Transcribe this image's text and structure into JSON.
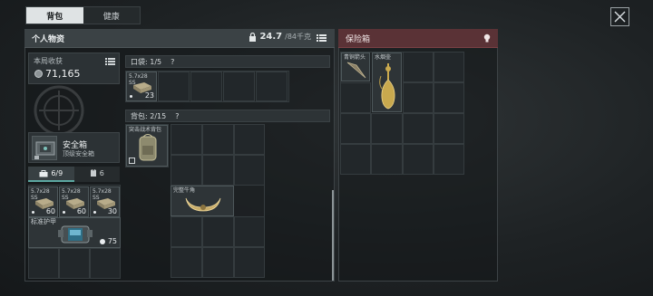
{
  "tabs": [
    {
      "label": "背包"
    },
    {
      "label": "健康"
    }
  ],
  "panel": {
    "title": "个人物资",
    "weight": "24.7",
    "weight_max": "/84千克"
  },
  "loot": {
    "label": "本局收获",
    "value": "71,165"
  },
  "safe_box": {
    "name": "安全箱",
    "subtitle": "顶级安全箱"
  },
  "subtabs": [
    {
      "label": "6/9",
      "icon": "briefcase-icon"
    },
    {
      "label": "6",
      "icon": "vest-icon"
    }
  ],
  "left_items": [
    {
      "name": "5.7x28",
      "sub": "SS",
      "count": "60"
    },
    {
      "name": "5.7x28",
      "sub": "SS",
      "count": "60"
    },
    {
      "name": "5.7x28",
      "sub": "SS",
      "count": "30"
    }
  ],
  "armor": {
    "name": "标准护甲",
    "count": "75"
  },
  "pocket": {
    "label": "口袋: 1/5",
    "help": "?",
    "item_name": "5.7x28",
    "item_sub": "SS",
    "item_count": "23"
  },
  "backpack": {
    "label": "背包: 2/15",
    "help": "?",
    "item1_name": "突击战术背包",
    "item2_name": "完整牛角"
  },
  "vault": {
    "title": "保险箱",
    "item1_name": "青铜箭头",
    "item2_name": "水烟壶"
  },
  "colors": {
    "accent_teal": "#5ca7a0",
    "vault_red": "#5a3236"
  }
}
